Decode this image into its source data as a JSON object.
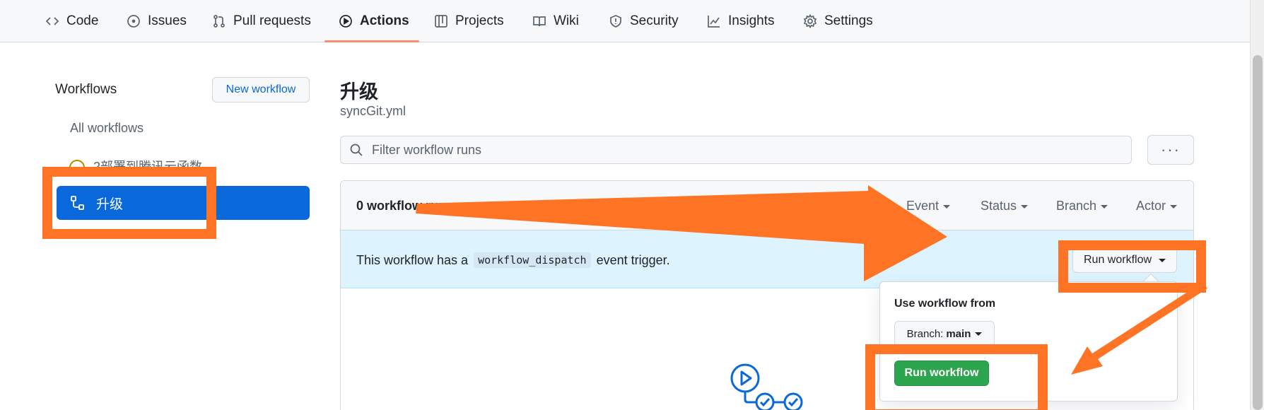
{
  "nav": {
    "tabs": [
      {
        "label": "Code",
        "icon": "code-icon"
      },
      {
        "label": "Issues",
        "icon": "issue-icon"
      },
      {
        "label": "Pull requests",
        "icon": "pull-request-icon"
      },
      {
        "label": "Actions",
        "icon": "play-icon",
        "active": true
      },
      {
        "label": "Projects",
        "icon": "project-icon"
      },
      {
        "label": "Wiki",
        "icon": "book-icon"
      },
      {
        "label": "Security",
        "icon": "shield-icon"
      },
      {
        "label": "Insights",
        "icon": "graph-icon"
      },
      {
        "label": "Settings",
        "icon": "gear-icon"
      }
    ],
    "active_underline_color": "#fd8c73"
  },
  "sidebar": {
    "title": "Workflows",
    "new_workflow_label": "New workflow",
    "all_workflows_label": "All workflows",
    "items": [
      {
        "label": "2部署到腾讯云函数",
        "icon": "warning-icon"
      },
      {
        "label": "升级",
        "icon": "workflow-icon",
        "selected": true
      }
    ],
    "selected_color": "#0969da"
  },
  "main": {
    "title": "升级",
    "file": "syncGit.yml",
    "filter_placeholder": "Filter workflow runs",
    "more_label": "···",
    "runs_count": "0 workflow runs",
    "filters": [
      "Event",
      "Status",
      "Branch",
      "Actor"
    ],
    "dispatch_prefix": "This workflow has a",
    "dispatch_code": "workflow_dispatch",
    "dispatch_suffix": "event trigger.",
    "run_workflow_label": "Run workflow"
  },
  "popover": {
    "label": "Use workflow from",
    "branch_prefix": "Branch:",
    "branch_value": "main",
    "submit_label": "Run workflow",
    "submit_color": "#2da44e"
  },
  "annotations": {
    "color": "#ff7324"
  }
}
